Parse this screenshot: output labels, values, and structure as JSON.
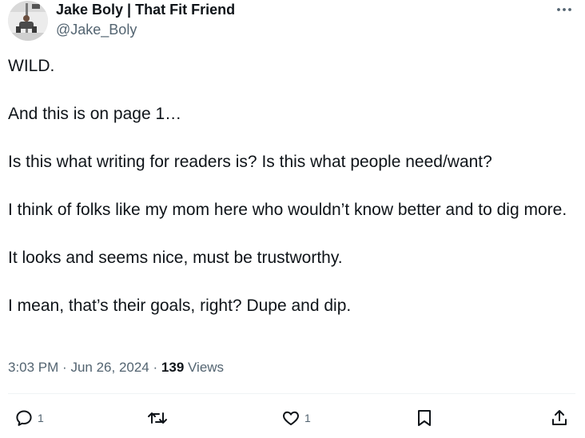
{
  "author": {
    "name": "Jake Boly | That Fit Friend",
    "handle": "@Jake_Boly"
  },
  "tweet": {
    "paragraphs": [
      "WILD.",
      "And this is on page 1…",
      "Is this what writing for readers is? Is this what people need/want?",
      "I think of folks like my mom here who wouldn’t know better and to dig more.",
      "It looks and seems nice, must be trustworthy.",
      "I mean, that’s their goals, right? Dupe and dip."
    ]
  },
  "meta": {
    "time": "3:03 PM",
    "separator": "·",
    "date": "Jun 26, 2024",
    "views_count": "139",
    "views_label": "Views"
  },
  "actions": {
    "reply_count": "1",
    "like_count": "1"
  },
  "icons": {
    "more": "more-dots-icon",
    "reply": "reply-icon",
    "retweet": "retweet-icon",
    "like": "heart-icon",
    "bookmark": "bookmark-icon",
    "share": "share-icon"
  },
  "colors": {
    "text": "#0f1419",
    "secondary": "#536471",
    "divider": "#eff3f4"
  }
}
